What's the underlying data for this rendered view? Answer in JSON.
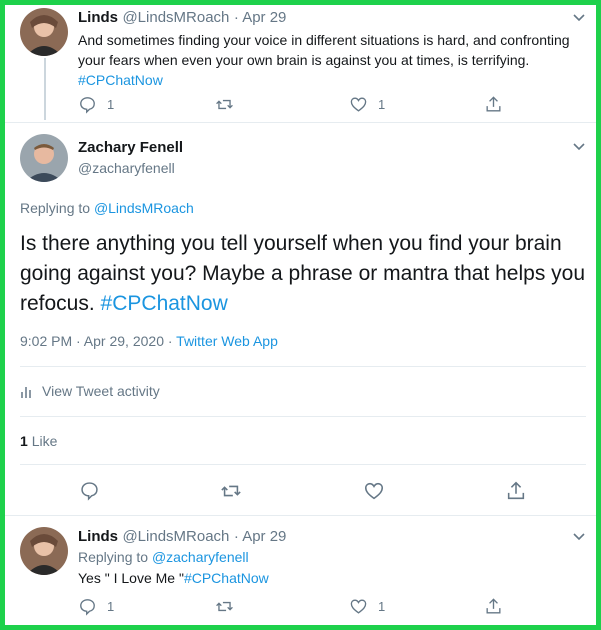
{
  "colors": {
    "accent": "#1b95e0",
    "frame": "#1ed14b",
    "muted": "#657786",
    "divider": "#e6ecf0"
  },
  "tweet1": {
    "name": "Linds",
    "handle": "@LindsMRoach",
    "date": "· Apr 29",
    "text": "And sometimes finding your voice in different situations is hard, and confronting your fears when even your own brain is against you at times, is terrifying.",
    "hashtag": "#CPChatNow",
    "replies": "1",
    "likes": "1"
  },
  "main": {
    "name": "Zachary Fenell",
    "handle": "@zacharyfenell",
    "replying_prefix": "Replying to",
    "replying_to": "@LindsMRoach",
    "text": "Is there anything you tell yourself when you find your brain going against you? Maybe a phrase or mantra that helps you refocus.",
    "hashtag": "#CPChatNow",
    "timestamp": "9:02 PM · Apr 29, 2020 ·",
    "source": "Twitter Web App",
    "activity_label": "View Tweet activity",
    "like_count": "1",
    "like_label": "Like"
  },
  "tweet3": {
    "name": "Linds",
    "handle": "@LindsMRoach",
    "date": "· Apr 29",
    "replying_prefix": "Replying to",
    "replying_to": "@zacharyfenell",
    "text": "Yes \" I Love Me \"",
    "hashtag": "#CPChatNow",
    "replies": "1",
    "likes": "1"
  },
  "icons": [
    "chevron-down-icon",
    "reply-icon",
    "retweet-icon",
    "like-icon",
    "share-icon",
    "activity-bars-icon"
  ]
}
